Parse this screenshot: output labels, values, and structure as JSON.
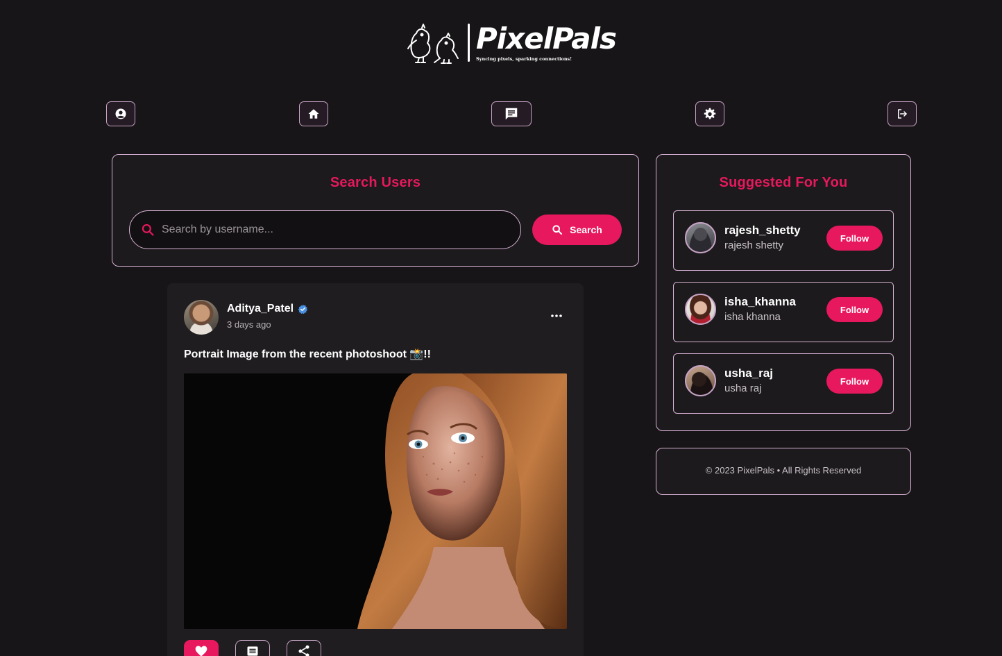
{
  "brand": {
    "name": "PixelPals",
    "tagline": "Syncing pixels, sparking connections!"
  },
  "nav": [
    {
      "name": "profile",
      "icon": "user-circle-icon"
    },
    {
      "name": "home",
      "icon": "home-icon"
    },
    {
      "name": "messages",
      "icon": "message-icon"
    },
    {
      "name": "settings",
      "icon": "gear-icon"
    },
    {
      "name": "logout",
      "icon": "logout-icon"
    }
  ],
  "search": {
    "title": "Search Users",
    "placeholder": "Search by username...",
    "value": "",
    "button_label": "Search"
  },
  "post": {
    "author": "Aditya_Patel",
    "verified": true,
    "time": "3 days ago",
    "caption": "Portrait Image from the recent photoshoot 📸!!",
    "liked": true
  },
  "suggestions": {
    "title": "Suggested For You",
    "items": [
      {
        "username": "rajesh_shetty",
        "name": "rajesh shetty",
        "button": "Follow"
      },
      {
        "username": "isha_khanna",
        "name": "isha khanna",
        "button": "Follow"
      },
      {
        "username": "usha_raj",
        "name": "usha raj",
        "button": "Follow"
      }
    ]
  },
  "footer": {
    "text": "© 2023 PixelPals • All Rights Reserved"
  },
  "colors": {
    "background": "#171517",
    "accent": "#e8185e",
    "border": "#d8b3d6",
    "nav_bg": "#241b24"
  }
}
